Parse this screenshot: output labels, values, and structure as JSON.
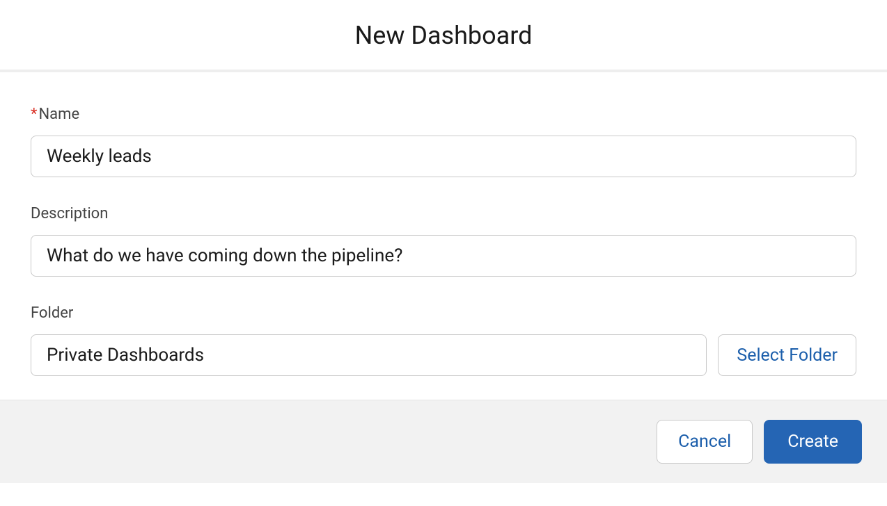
{
  "header": {
    "title": "New Dashboard"
  },
  "form": {
    "name": {
      "label": "Name",
      "required_marker": "*",
      "value": "Weekly leads"
    },
    "description": {
      "label": "Description",
      "value": "What do we have coming down the pipeline?"
    },
    "folder": {
      "label": "Folder",
      "value": "Private Dashboards",
      "select_button": "Select Folder"
    }
  },
  "footer": {
    "cancel": "Cancel",
    "create": "Create"
  }
}
